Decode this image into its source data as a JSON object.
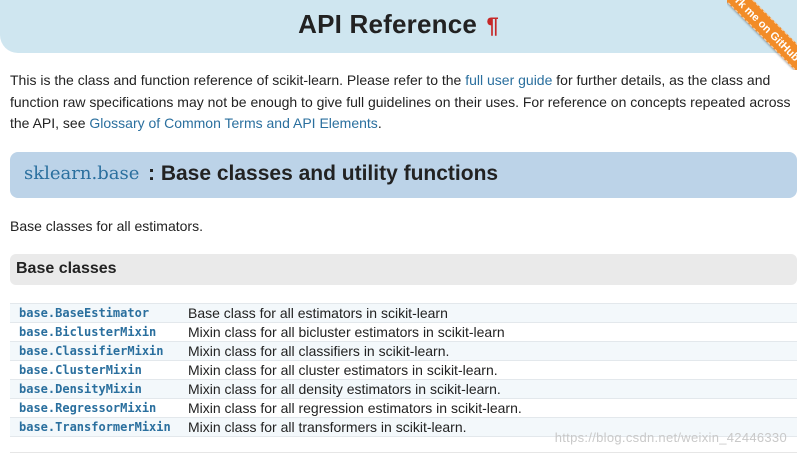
{
  "page": {
    "title": "API Reference",
    "title_anchor": "¶",
    "ribbon": "Fork me on GitHub"
  },
  "intro": {
    "part1": "This is the class and function reference of scikit-learn. Please refer to the ",
    "link1": "full user guide",
    "part2": " for further details, as the class and function raw specifications may not be enough to give full guidelines on their uses. For reference on concepts repeated across the API, see ",
    "link2": "Glossary of Common Terms and API Elements",
    "part3": "."
  },
  "module": {
    "code": "sklearn.base",
    "title": ": Base classes and utility functions",
    "description": "Base classes for all estimators."
  },
  "section": {
    "title": "Base classes"
  },
  "classes": [
    {
      "name": "base.BaseEstimator",
      "description": "Base class for all estimators in scikit-learn"
    },
    {
      "name": "base.BiclusterMixin",
      "description": "Mixin class for all bicluster estimators in scikit-learn"
    },
    {
      "name": "base.ClassifierMixin",
      "description": "Mixin class for all classifiers in scikit-learn."
    },
    {
      "name": "base.ClusterMixin",
      "description": "Mixin class for all cluster estimators in scikit-learn."
    },
    {
      "name": "base.DensityMixin",
      "description": "Mixin class for all density estimators in scikit-learn."
    },
    {
      "name": "base.RegressorMixin",
      "description": "Mixin class for all regression estimators in scikit-learn."
    },
    {
      "name": "base.TransformerMixin",
      "description": "Mixin class for all transformers in scikit-learn."
    }
  ],
  "watermark": "https://blog.csdn.net/weixin_42446330",
  "colors": {
    "link": "#2a6f9e",
    "title_band": "#cfe6f0",
    "module_header": "#bcd3e8",
    "ribbon": "#f28c28",
    "anchor": "#c62828"
  }
}
